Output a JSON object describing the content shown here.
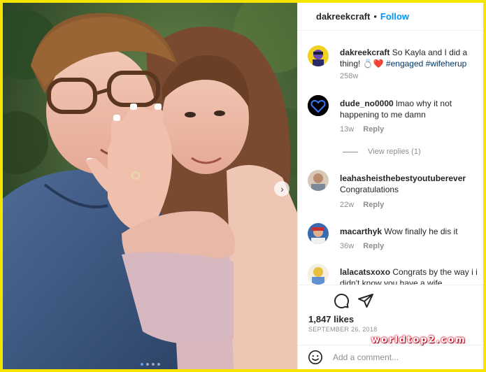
{
  "post": {
    "username": "dakreekcraft",
    "separator": "•",
    "follow_label": "Follow",
    "caption": {
      "user": "dakreekcraft",
      "text": "So Kayla and I did a thing! 💍❤️",
      "tags": "#engaged #wifeherup",
      "time": "258w"
    },
    "likes": "1,847 likes",
    "date": "SEPTEMBER 26, 2018",
    "carousel": {
      "slides": 4,
      "active": 1
    }
  },
  "comments": [
    {
      "user": "dude_no0000",
      "text": "lmao why it not happening to me damn",
      "time": "13w",
      "reply": "Reply"
    },
    {
      "user": "leahasheisthebestyoutuberever",
      "text": "Congratulations",
      "time": "22w",
      "reply": "Reply"
    },
    {
      "user": "macarthyk",
      "text": "Wow finally he dis it",
      "time": "36w",
      "reply": "Reply"
    },
    {
      "user": "lalacatsxoxo",
      "text": "Congrats by the way i i didn't know you have a wife",
      "time": "",
      "reply": ""
    }
  ],
  "view_replies": "View replies (1)",
  "add_comment": {
    "placeholder": "Add a comment..."
  },
  "watermark": "worldtop2.com",
  "icons": {
    "carousel_next": "chevron-right-icon",
    "comment": "comment-bubble-icon",
    "share": "paper-plane-icon",
    "emoji": "smiley-face-icon"
  },
  "colors": {
    "frame": "#f5e400",
    "link": "#0095f6",
    "secondary_text": "#8e8e8e"
  }
}
